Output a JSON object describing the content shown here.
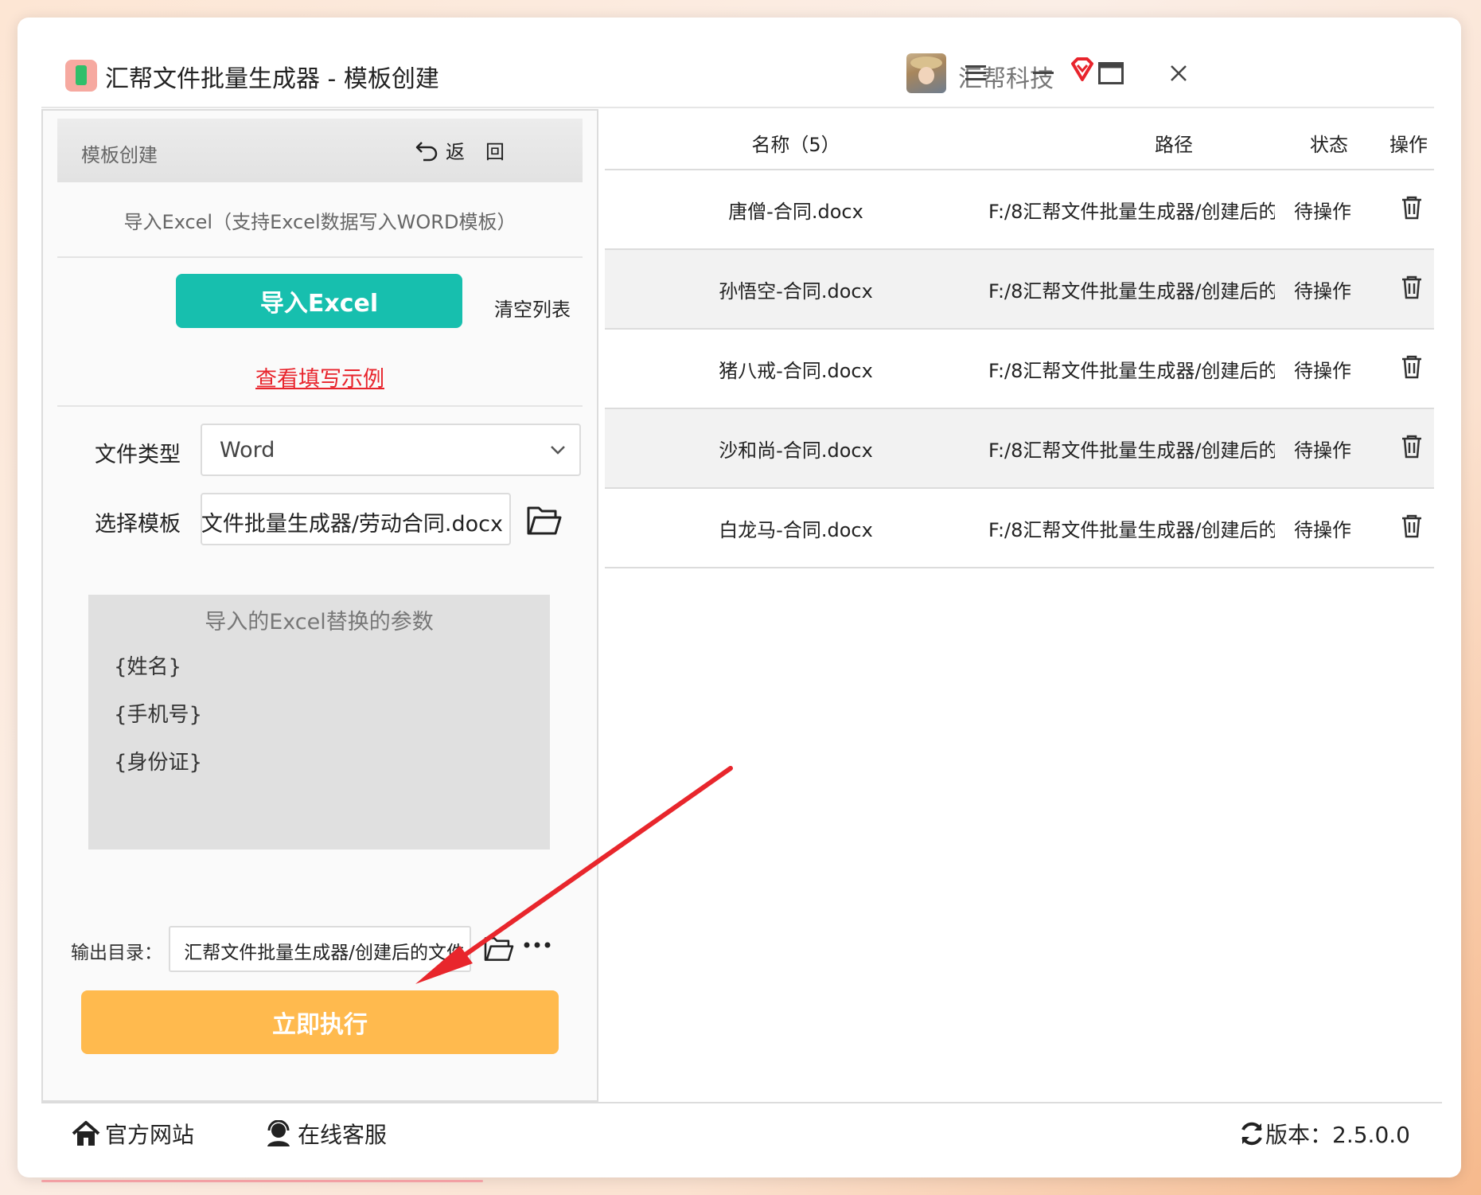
{
  "app": {
    "title": "汇帮文件批量生成器 - 模板创建",
    "brand": "汇帮科技"
  },
  "left": {
    "header_title": "模板创建",
    "back_label": "返回",
    "import_hint": "导入Excel（支持Excel数据写入WORD模板）",
    "import_button": "导入Excel",
    "clear_list": "清空列表",
    "example_link": "查看填写示例",
    "file_type_label": "文件类型",
    "file_type_value": "Word",
    "template_label": "选择模板",
    "template_path": "文件批量生成器/劳动合同.docx",
    "params_title": "导入的Excel替换的参数",
    "params": [
      "{姓名}",
      "{手机号}",
      "{身份证}"
    ],
    "output_label": "输出目录：",
    "output_path": "汇帮文件批量生成器/创建后的文件",
    "run_button": "立即执行"
  },
  "table": {
    "headers": {
      "name": "名称（5）",
      "path": "路径",
      "status": "状态",
      "action": "操作"
    },
    "rows": [
      {
        "name": "唐僧-合同.docx",
        "path": "F:/8汇帮文件批量生成器/创建后的",
        "status": "待操作"
      },
      {
        "name": "孙悟空-合同.docx",
        "path": "F:/8汇帮文件批量生成器/创建后的",
        "status": "待操作"
      },
      {
        "name": "猪八戒-合同.docx",
        "path": "F:/8汇帮文件批量生成器/创建后的",
        "status": "待操作"
      },
      {
        "name": "沙和尚-合同.docx",
        "path": "F:/8汇帮文件批量生成器/创建后的",
        "status": "待操作"
      },
      {
        "name": "白龙马-合同.docx",
        "path": "F:/8汇帮文件批量生成器/创建后的",
        "status": "待操作"
      }
    ]
  },
  "footer": {
    "website": "官方网站",
    "support": "在线客服",
    "version": "版本：2.5.0.0"
  },
  "colors": {
    "import_btn": "#17bfae",
    "run_btn": "#ffba4e",
    "link": "#e8242c",
    "arrow": "#e8262c"
  },
  "icons": [
    "app-icon",
    "gem-icon",
    "menu-icon",
    "minimize-icon",
    "maximize-icon",
    "close-icon",
    "back-arrow-icon",
    "chevron-down-icon",
    "folder-icon",
    "more-icon",
    "trash-icon",
    "home-icon",
    "headset-icon",
    "refresh-icon"
  ]
}
